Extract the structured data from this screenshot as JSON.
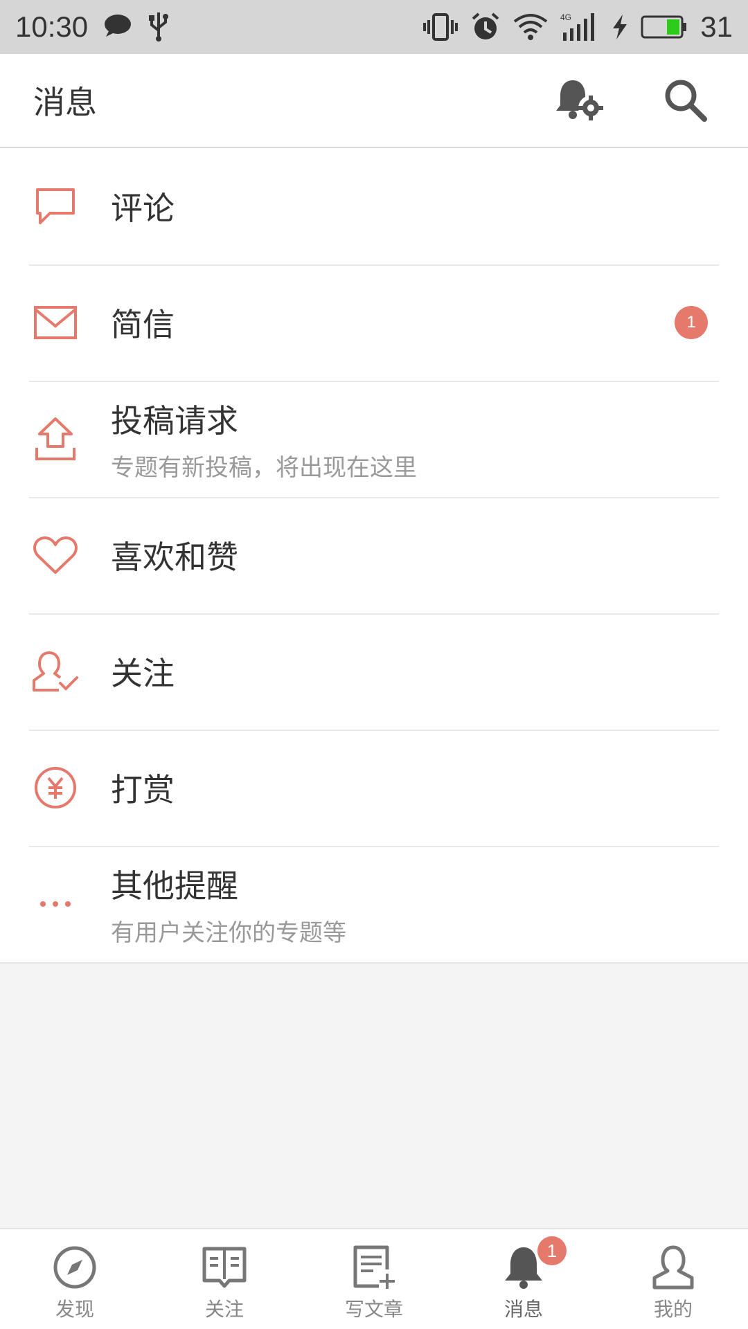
{
  "status_bar": {
    "time": "10:30",
    "battery_level": "31",
    "network": "4G",
    "icons": [
      "chat-bubble-icon",
      "usb-icon",
      "vibrate-icon",
      "alarm-icon",
      "wifi-icon",
      "signal-icon",
      "charging-icon",
      "battery-icon"
    ]
  },
  "header": {
    "title": "消息",
    "actions": [
      "notification-settings-icon",
      "search-icon"
    ]
  },
  "messages": {
    "items": [
      {
        "label": "评论",
        "icon": "comment-icon"
      },
      {
        "label": "简信",
        "icon": "mail-icon",
        "badge": "1"
      },
      {
        "label": "投稿请求",
        "subtitle": "专题有新投稿，将出现在这里",
        "icon": "upload-icon"
      },
      {
        "label": "喜欢和赞",
        "icon": "heart-icon"
      },
      {
        "label": "关注",
        "icon": "user-check-icon"
      },
      {
        "label": "打赏",
        "icon": "yuan-icon"
      },
      {
        "label": "其他提醒",
        "subtitle": "有用户关注你的专题等",
        "icon": "more-dots-icon"
      }
    ]
  },
  "bottom_nav": {
    "items": [
      {
        "label": "发现",
        "icon": "compass-icon"
      },
      {
        "label": "关注",
        "icon": "book-icon"
      },
      {
        "label": "写文章",
        "icon": "write-article-icon"
      },
      {
        "label": "消息",
        "icon": "bell-icon",
        "badge": "1",
        "active": true
      },
      {
        "label": "我的",
        "icon": "profile-icon"
      }
    ]
  },
  "colors": {
    "accent": "#e5796b",
    "icon_gray": "#555555",
    "status_bar_bg": "#d6d6d6",
    "battery_green": "#2ecc1a"
  }
}
